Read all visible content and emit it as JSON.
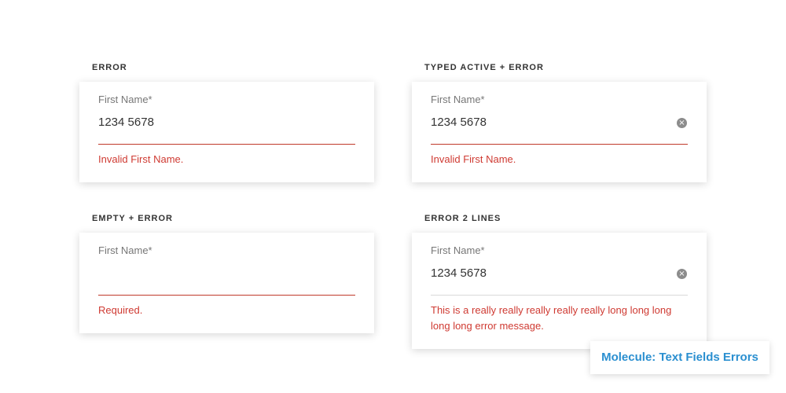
{
  "examples": [
    {
      "section_label": "ERROR",
      "field_label": "First Name*",
      "value": "1234 5678",
      "error_message": "Invalid First Name."
    },
    {
      "section_label": "TYPED ACTIVE + ERROR",
      "field_label": "First Name*",
      "value": "1234 5678",
      "clear_icon": "clear-circle-icon",
      "clear_glyph": "×",
      "error_message": "Invalid First Name."
    },
    {
      "section_label": "EMPTY + ERROR",
      "field_label": "First Name*",
      "value": "",
      "error_message": "Required."
    },
    {
      "section_label": "ERROR 2 LINES",
      "field_label": "First Name*",
      "value": "1234 5678",
      "clear_icon": "clear-circle-icon",
      "clear_glyph": "×",
      "error_message": "This is a really really really really really long  long long long long error message."
    }
  ],
  "caption": "Molecule: Text Fields Errors",
  "colors": {
    "error": "#cf3a32",
    "error_underline": "#c0392b",
    "neutral_underline": "#d9d9d9",
    "caption": "#2a8fd0",
    "label": "#777777",
    "value": "#333333"
  }
}
